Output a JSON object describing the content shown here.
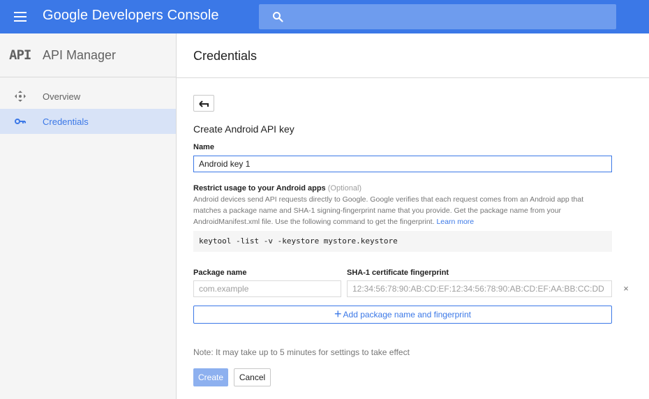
{
  "header": {
    "brand": "Google Developers Console",
    "search": {
      "placeholder": "",
      "value": ""
    },
    "icons": {
      "menu": "hamburger-menu-icon",
      "search": "search-icon"
    }
  },
  "sidebar": {
    "logo": "API",
    "title": "API Manager",
    "items": [
      {
        "label": "Overview",
        "icon": "overview-icon",
        "active": false
      },
      {
        "label": "Credentials",
        "icon": "key-icon",
        "active": true
      }
    ]
  },
  "main": {
    "title": "Credentials",
    "form": {
      "title": "Create Android API key",
      "name_label": "Name",
      "name_value": "Android key 1",
      "restrict_label": "Restrict usage to your Android apps",
      "restrict_optional": "(Optional)",
      "description": "Android devices send API requests directly to Google. Google verifies that each request comes from an Android app that matches a package name and SHA-1 signing-fingerprint name that you provide. Get the package name from your AndroidManifest.xml file. Use the following command to get the fingerprint.",
      "learn_more": "Learn more",
      "command": "keytool -list -v -keystore mystore.keystore",
      "package_label": "Package name",
      "package_placeholder": "com.example",
      "sha_label": "SHA-1 certificate fingerprint",
      "sha_placeholder": "12:34:56:78:90:AB:CD:EF:12:34:56:78:90:AB:CD:EF:AA:BB:CC:DD",
      "remove_symbol": "×",
      "add_button": "Add package name and fingerprint",
      "note": "Note: It may take up to 5 minutes for settings to take effect",
      "create_button": "Create",
      "cancel_button": "Cancel"
    }
  },
  "colors": {
    "primary": "#3b78e7",
    "sidebar_active": "#d8e3f7",
    "create_disabled": "#8db0ef"
  }
}
